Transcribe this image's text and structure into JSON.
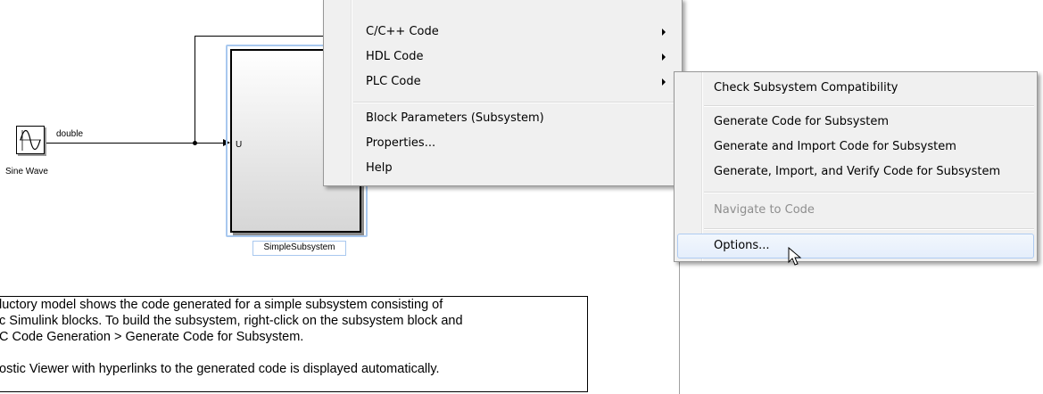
{
  "diagram": {
    "sine_block_label": "Sine Wave",
    "signal_type_label": "double",
    "subsystem_port_label": "U",
    "subsystem_name": "SimpleSubsystem"
  },
  "note": {
    "lines": [
      "luctory model shows the code generated for a simple subsystem consisting of",
      "c Simulink blocks.  To build the subsystem, right-click on the subsystem block and",
      "C Code Generation > Generate Code for Subsystem.",
      "",
      "ostic Viewer with hyperlinks to the generated code is displayed automatically."
    ]
  },
  "context_menu": {
    "items": [
      {
        "label": "C/C++ Code",
        "submenu": true
      },
      {
        "label": "HDL Code",
        "submenu": true
      },
      {
        "label": "PLC Code",
        "submenu": true
      },
      {
        "label": "Block Parameters (Subsystem)",
        "submenu": false
      },
      {
        "label": "Properties...",
        "submenu": false
      },
      {
        "label": "Help",
        "submenu": false
      }
    ]
  },
  "submenu": {
    "items": [
      {
        "label": "Check Subsystem Compatibility",
        "enabled": true
      },
      {
        "label": "Generate Code for Subsystem",
        "enabled": true
      },
      {
        "label": "Generate and Import Code for Subsystem",
        "enabled": true
      },
      {
        "label": "Generate, Import, and Verify Code for Subsystem",
        "enabled": true
      },
      {
        "label": "Navigate to Code",
        "enabled": false
      },
      {
        "label": "Options...",
        "enabled": true,
        "highlighted": true
      }
    ]
  },
  "icons": {
    "sine": "sine-wave-icon",
    "submenu_arrow": "chevron-right-icon",
    "cursor": "mouse-pointer-icon"
  },
  "colors": {
    "selection": "#a8c8ef",
    "menu_background": "#f0f0f0",
    "menu_hover": "#e5eefb",
    "disabled_text": "#8e8e8e"
  }
}
